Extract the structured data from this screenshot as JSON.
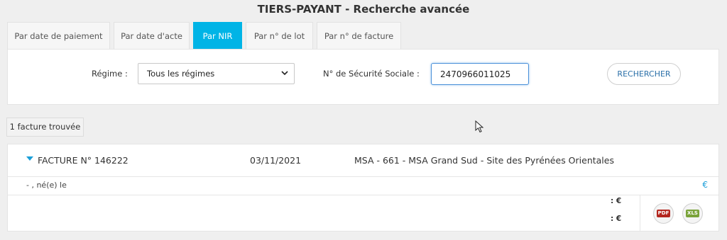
{
  "header": {
    "title": "TIERS-PAYANT - Recherche avancée"
  },
  "tabs": [
    {
      "label": "Par date de paiement"
    },
    {
      "label": "Par date d'acte"
    },
    {
      "label": "Par NIR"
    },
    {
      "label": "Par n° de lot"
    },
    {
      "label": "Par n° de facture"
    }
  ],
  "active_tab": "Par NIR",
  "colors": {
    "accent": "#00b4e6",
    "link": "#1a9ed8",
    "pdf": "#b3261e",
    "xls": "#7aa33a"
  },
  "search": {
    "regime_label": "Régime :",
    "regime_value": "Tous les régimes",
    "nss_label": "N° de Sécurité Sociale :",
    "nss_value": "2470966011025",
    "button_label": "RECHERCHER"
  },
  "results": {
    "count_label": "1 facture trouvée",
    "invoice": {
      "number": "FACTURE N° 146222",
      "date": "03/11/2021",
      "organism": "MSA - 661 - MSA Grand Sud - Site des Pyrénées Orientales",
      "patient": "- , né(e) le",
      "euro_symbol": "€",
      "amount_1": ": €",
      "amount_2": ": €",
      "pdf_label": "PDF",
      "xls_label": "XLS"
    }
  },
  "icons": {
    "expand": "caret-down-icon",
    "pdf": "pdf-icon",
    "xls": "xls-icon",
    "cursor": "mouse-cursor-icon"
  }
}
